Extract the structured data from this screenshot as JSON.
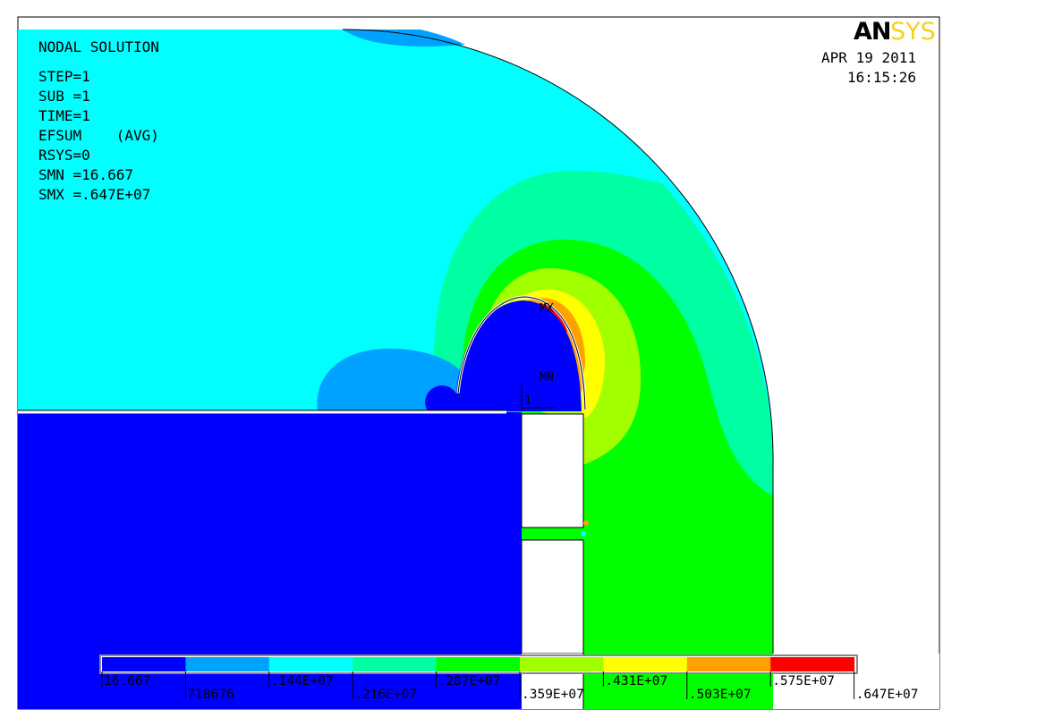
{
  "info": {
    "lines": [
      "NODAL SOLUTION",
      "STEP=1",
      "SUB =1",
      "TIME=1",
      "EFSUM    (AVG)",
      "RSYS=0",
      "SMN =16.667",
      "SMX =.647E+07"
    ]
  },
  "logo": {
    "an": "AN",
    "sys": "SYS"
  },
  "date": {
    "line1": "APR 19 2011",
    "line2": "16:15:26"
  },
  "markers": {
    "max": "MX",
    "min": "MN",
    "node": "1"
  },
  "legend": {
    "labels": [
      "16.667",
      "718676",
      ".144E+07",
      ".216E+07",
      ".287E+07",
      ".359E+07",
      ".431E+07",
      ".503E+07",
      ".575E+07",
      ".647E+07"
    ],
    "colors": [
      "#0000ff",
      "#00a2ff",
      "#00ffff",
      "#00ffa2",
      "#00ff00",
      "#a2ff00",
      "#ffff00",
      "#ffa200",
      "#ff0000"
    ]
  }
}
